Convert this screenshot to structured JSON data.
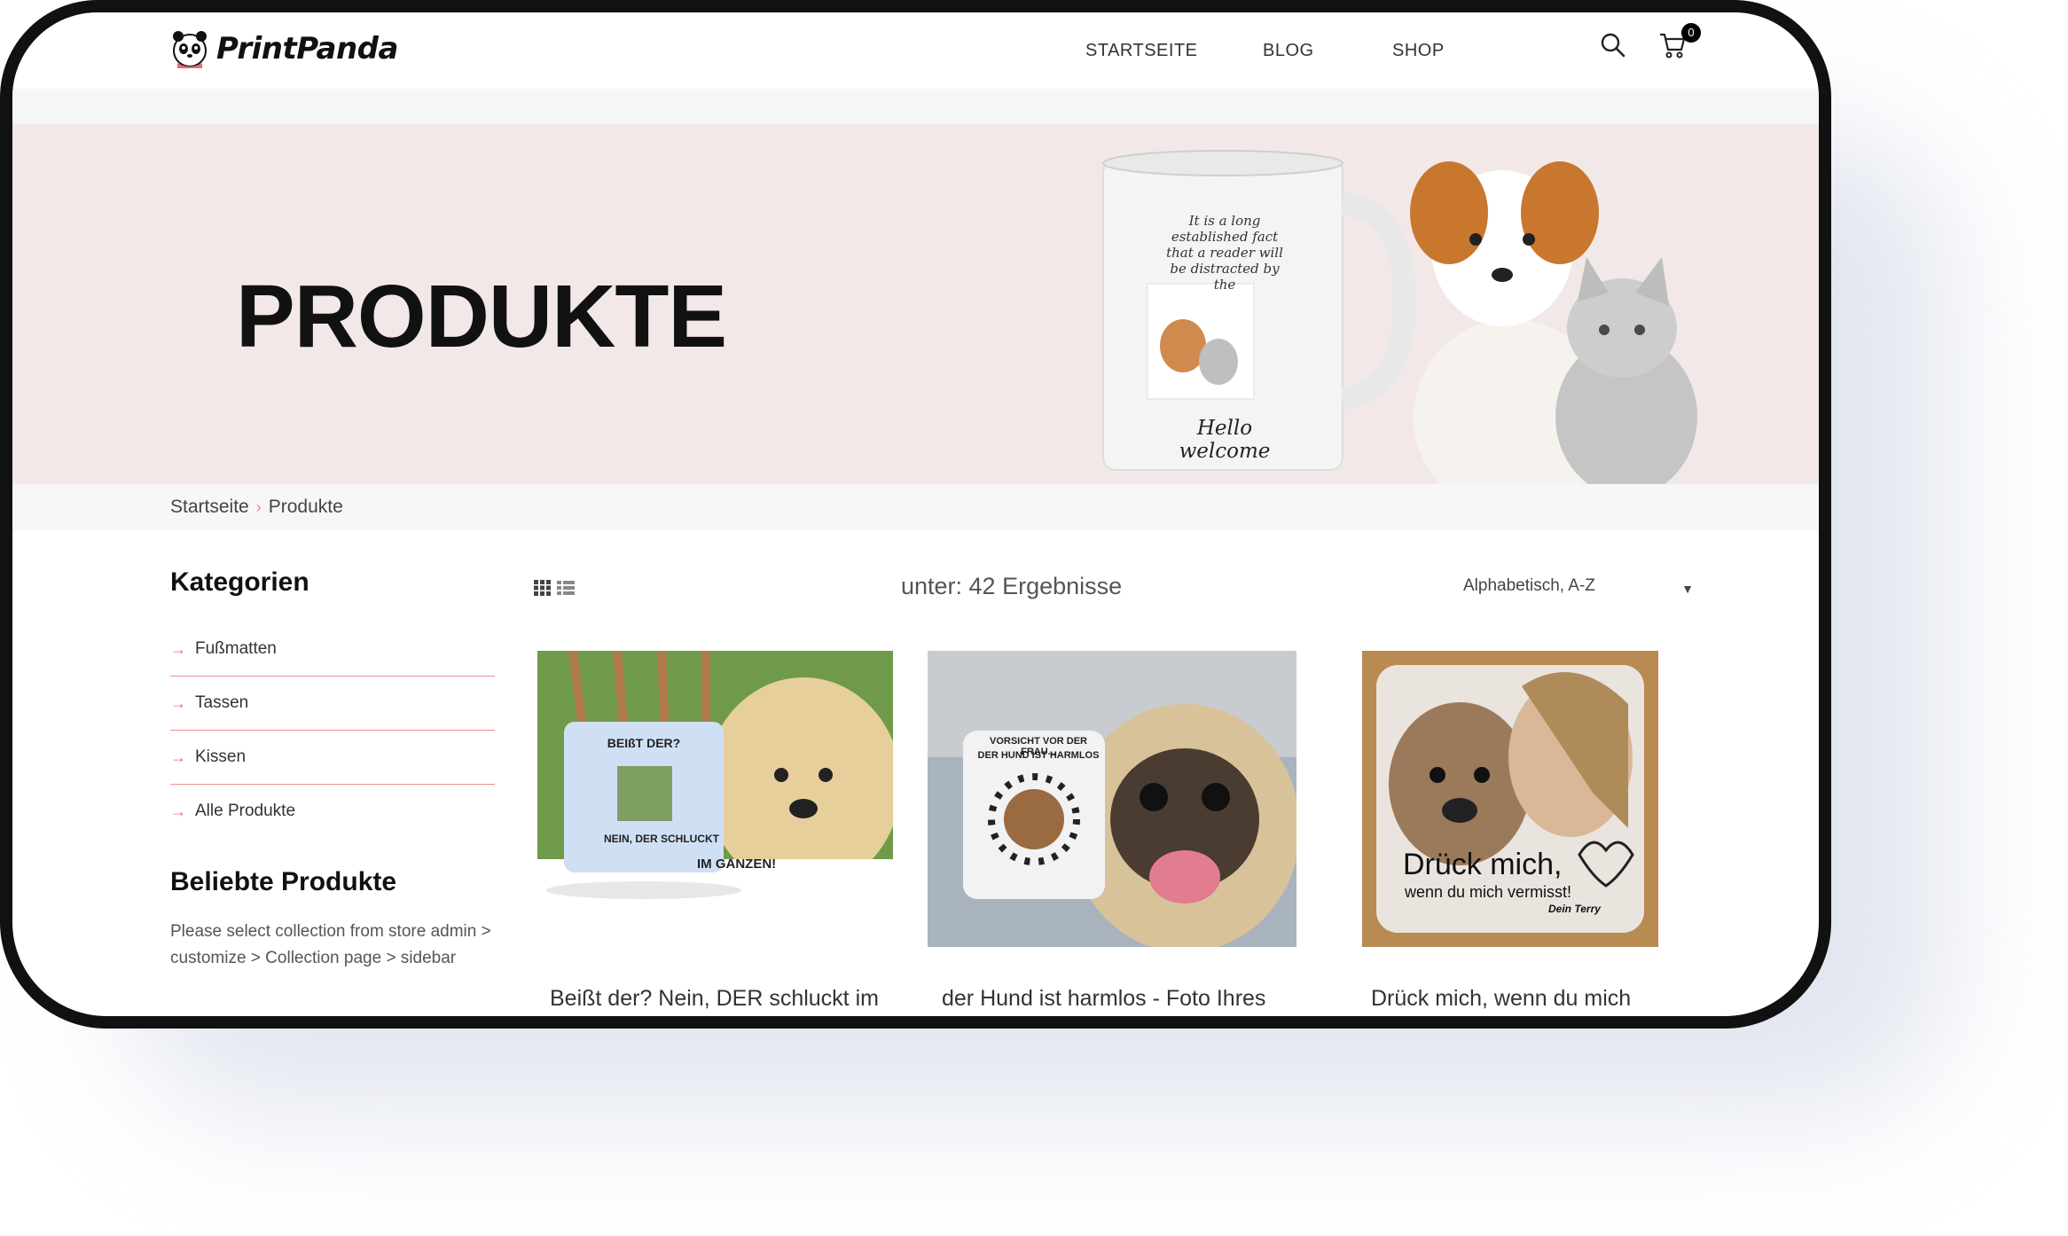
{
  "brand": {
    "name": "PrintPanda"
  },
  "nav": {
    "items": [
      "STARTSEITE",
      "BLOG",
      "SHOP"
    ]
  },
  "cart": {
    "count": "0"
  },
  "hero": {
    "title": "PRODUKTE",
    "mug_text": "It is a long established fact that a reader will be distracted by the",
    "mug_caption": "Hello welcome"
  },
  "breadcrumb": {
    "home": "Startseite",
    "separator": "›",
    "current": "Produkte"
  },
  "sidebar": {
    "categories_title": "Kategorien",
    "categories": [
      "Fußmatten",
      "Tassen",
      "Kissen",
      "Alle Produkte"
    ],
    "popular_title": "Beliebte Produkte",
    "popular_note": "Please select collection from store admin > customize > Collection page > sidebar"
  },
  "toolbar": {
    "result_count": "unter: 42 Ergebnisse",
    "sort_selected": "Alphabetisch, A-Z"
  },
  "products": [
    {
      "title": "Beißt der? Nein, DER schluckt im",
      "mug_top": "BEIßT DER?",
      "mug_bottom": "NEIN, DER SCHLUCKT",
      "mug_tail": "IM GANZEN!"
    },
    {
      "title": "der Hund ist harmlos - Foto Ihres",
      "mug_top": "VORSICHT VOR DER FRAU...",
      "mug_bottom": "DER HUND IST HARMLOS"
    },
    {
      "title": "Drück mich, wenn du mich",
      "pillow_big": "Drück mich,",
      "pillow_small": "wenn du mich vermisst!",
      "pillow_sign": "Dein Terry"
    }
  ],
  "colors": {
    "hero_bg": "#f3e8e8",
    "accent": "#e96b6b",
    "frame": "#111111"
  }
}
